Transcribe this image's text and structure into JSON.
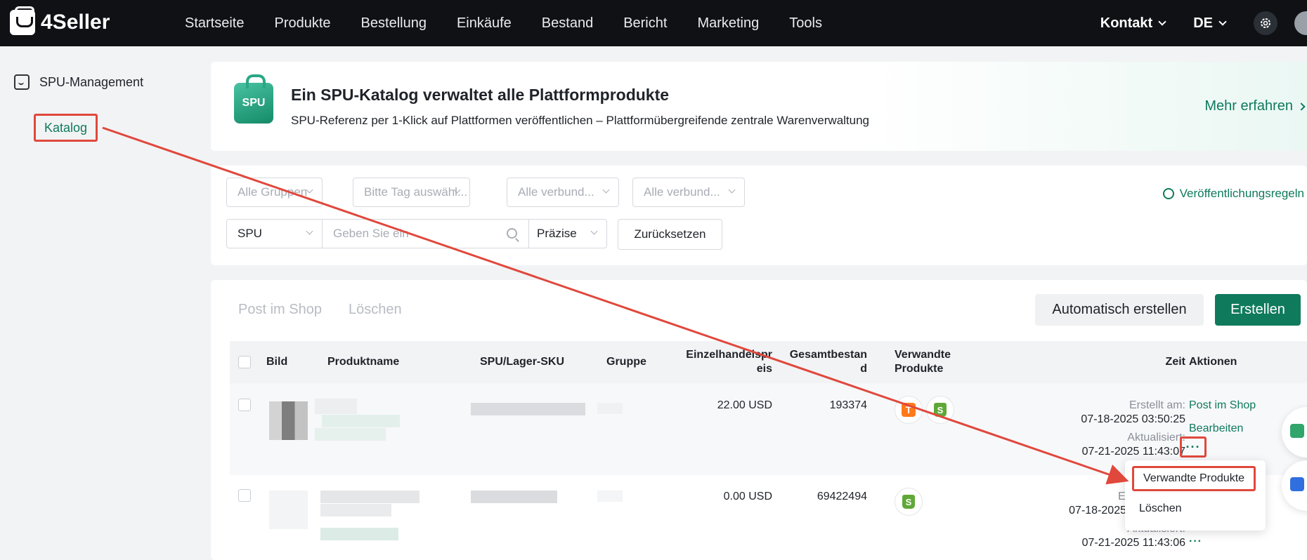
{
  "brand": {
    "name": "4Seller"
  },
  "nav": {
    "items": [
      "Startseite",
      "Produkte",
      "Bestellung",
      "Einkäufe",
      "Bestand",
      "Bericht",
      "Marketing",
      "Tools"
    ],
    "contact": "Kontakt",
    "language": "DE"
  },
  "sidebar": {
    "section": "SPU-Management",
    "item": "Katalog"
  },
  "banner": {
    "icon_text": "SPU",
    "title": "Ein SPU-Katalog verwaltet alle Plattformprodukte",
    "subtitle": "SPU-Referenz per 1-Klick auf Plattformen veröffentlichen – Plattformübergreifende zentrale Warenverwaltung",
    "link": "Mehr erfahren"
  },
  "filters": {
    "groups": "Alle Gruppen",
    "tag": "Bitte Tag auswähl...",
    "linked1": "Alle verbund...",
    "linked2": "Alle verbund...",
    "field": "SPU",
    "search_placeholder": "Geben Sie ein",
    "match": "Präzise",
    "reset": "Zurücksetzen",
    "rules": "Veröffentlichungsregeln"
  },
  "toolbar": {
    "post": "Post im Shop",
    "delete": "Löschen",
    "auto_create": "Automatisch erstellen",
    "create": "Erstellen"
  },
  "table": {
    "headers": {
      "image": "Bild",
      "name": "Produktname",
      "sku": "SPU/Lager-SKU",
      "group": "Gruppe",
      "price": "Einzelhandelspr eis",
      "stock": "Gesamtbestan d",
      "related": "Verwandte Produkte",
      "time": "Zeit",
      "actions": "Aktionen"
    },
    "rows": [
      {
        "price": "22.00 USD",
        "stock": "193374",
        "created_label": "Erstellt am:",
        "created": "07-18-2025 03:50:25",
        "updated_label": "Aktualisiert:",
        "updated": "07-21-2025 11:43:07",
        "action_post": "Post im Shop",
        "action_edit": "Bearbeiten",
        "more": "···"
      },
      {
        "price": "0.00 USD",
        "stock": "69422494",
        "created_label": "Er",
        "created": "07-18-2025",
        "updated_label": "Aktualisiert:",
        "updated": "07-21-2025 11:43:06",
        "more": "···"
      }
    ]
  },
  "dropdown": {
    "related": "Verwandte Produkte",
    "delete": "Löschen"
  },
  "colors": {
    "accent": "#0f7a5c",
    "highlight": "#e0483c",
    "topbar": "#0f1115"
  }
}
